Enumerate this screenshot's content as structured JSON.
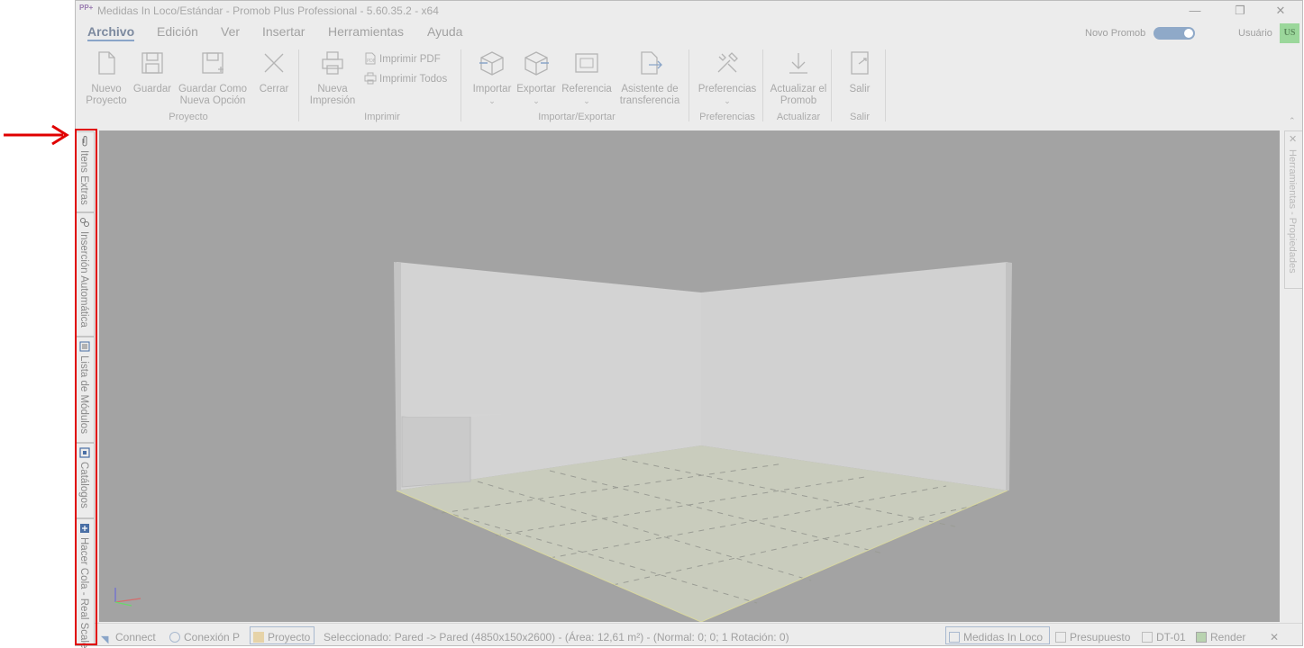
{
  "window": {
    "title": "Medidas In Loco/Estándar - Promob Plus Professional - 5.60.35.2 - x64",
    "logo_text": "PP+",
    "minimize_glyph": "—",
    "restore_glyph": "❐",
    "close_glyph": "✕"
  },
  "menu": [
    "Archivo",
    "Edición",
    "Ver",
    "Insertar",
    "Herramientas",
    "Ayuda"
  ],
  "header": {
    "toggle_label": "Novo Promob",
    "user_label": "Usuário",
    "avatar_text": "US"
  },
  "ribbon": {
    "nuevo": "Nuevo Proyecto",
    "guardar": "Guardar",
    "guardar_como": "Guardar Como Nueva Opción",
    "cerrar": "Cerrar",
    "nueva_impresion": "Nueva Impresión",
    "imprimir_pdf": "Imprimir PDF",
    "imprimir_todos": "Imprimir Todos",
    "importar": "Importar",
    "exportar": "Exportar",
    "referencia": "Referencia",
    "asistente": "Asistente de transferencia",
    "preferencias": "Preferencias",
    "actualizar": "Actualizar el Promob",
    "salir": "Salir",
    "groups": {
      "proyecto": "Proyecto",
      "imprimir": "Imprimir",
      "importar_exportar": "Importar/Exportar",
      "preferencias": "Preferencias",
      "actualizar": "Actualizar",
      "salir": "Salir"
    }
  },
  "sidebar_tabs": [
    {
      "label": "Itens Extras",
      "icon": "paperclip-icon"
    },
    {
      "label": "Inserción Automática",
      "icon": "gears-icon"
    },
    {
      "label": "Lista de Módulos",
      "icon": "list-icon"
    },
    {
      "label": "Catálogos",
      "icon": "catalog-icon"
    },
    {
      "label": "Hacer Cola - Real Scale",
      "icon": "queue-icon"
    }
  ],
  "right_panel": {
    "label": "Herramientas - Propiedades"
  },
  "statusbar": {
    "connect": "Connect",
    "conexion": "Conexión P",
    "proyecto": "Proyecto",
    "selection": "Seleccionado: Pared -> Pared (4850x150x2600) - (Área: 12,61 m²) - (Normal: 0; 0; 1 Rotación: 0)",
    "medidas": "Medidas In Loco",
    "presupuesto": "Presupuesto",
    "dt": "DT-01",
    "render": "Render",
    "close_glyph": "✕"
  },
  "colors": {
    "accent": "#8aa5c8",
    "highlight": "#e00000",
    "viewport": "#a3a3a3",
    "avatar": "#9bd79b"
  }
}
